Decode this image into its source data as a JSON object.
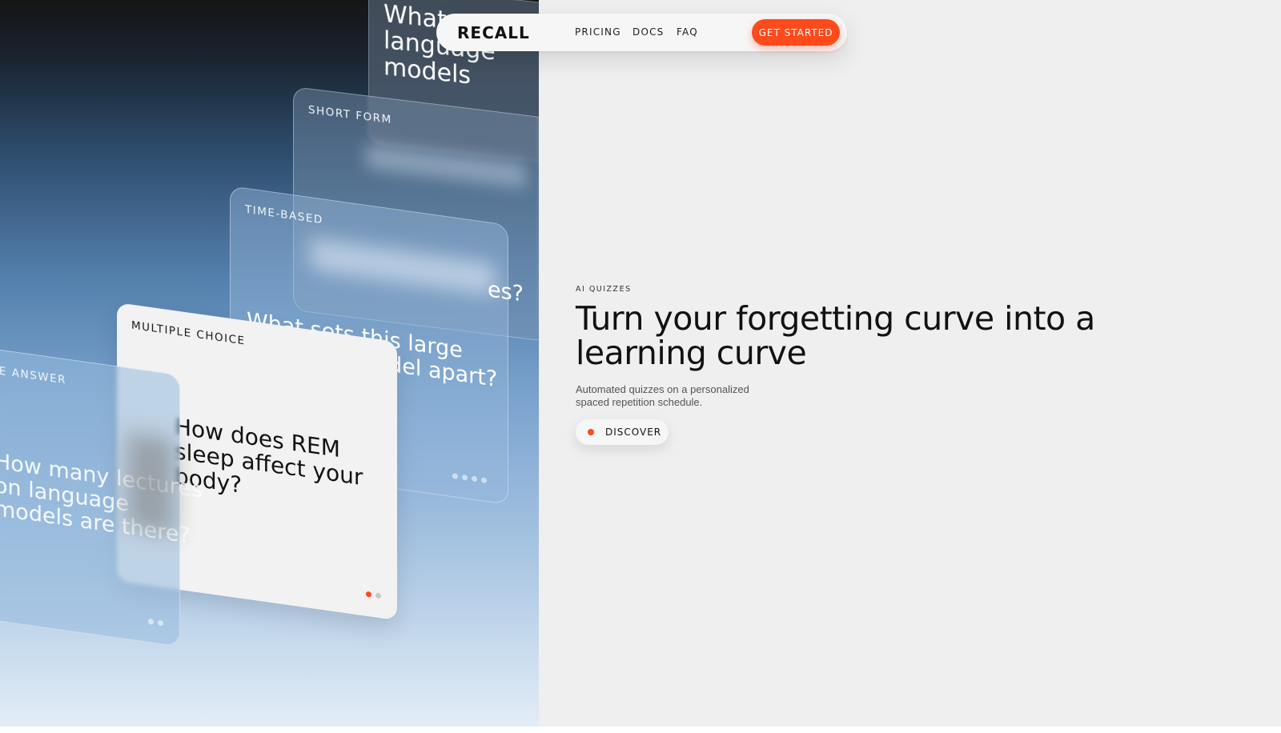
{
  "nav": {
    "logo": "RECALL",
    "links": [
      "PRICING",
      "DOCS",
      "FAQ"
    ],
    "cta": "GET STARTED"
  },
  "cards": {
    "top": {
      "question": "What ... language models"
    },
    "short_form": {
      "label": "SHORT FORM"
    },
    "time_based": {
      "label": "TIME-BASED",
      "question": "What sets this large language model apart?",
      "question_tail": "es?"
    },
    "multiple_choice": {
      "label": "MULTIPLE CHOICE",
      "question": "How does REM sleep affect your body?"
    },
    "answer": {
      "label": "E ANSWER",
      "question": "How many lectures on language models are there?"
    }
  },
  "hero": {
    "eyebrow": "AI QUIZZES",
    "headline": "Turn your forgetting curve into a learning curve",
    "subtext": "Automated quizzes on a personalized spaced repetition schedule.",
    "discover": "DISCOVER"
  },
  "colors": {
    "accent": "#ff4a1c",
    "background": "#efefef",
    "text": "#111111"
  }
}
